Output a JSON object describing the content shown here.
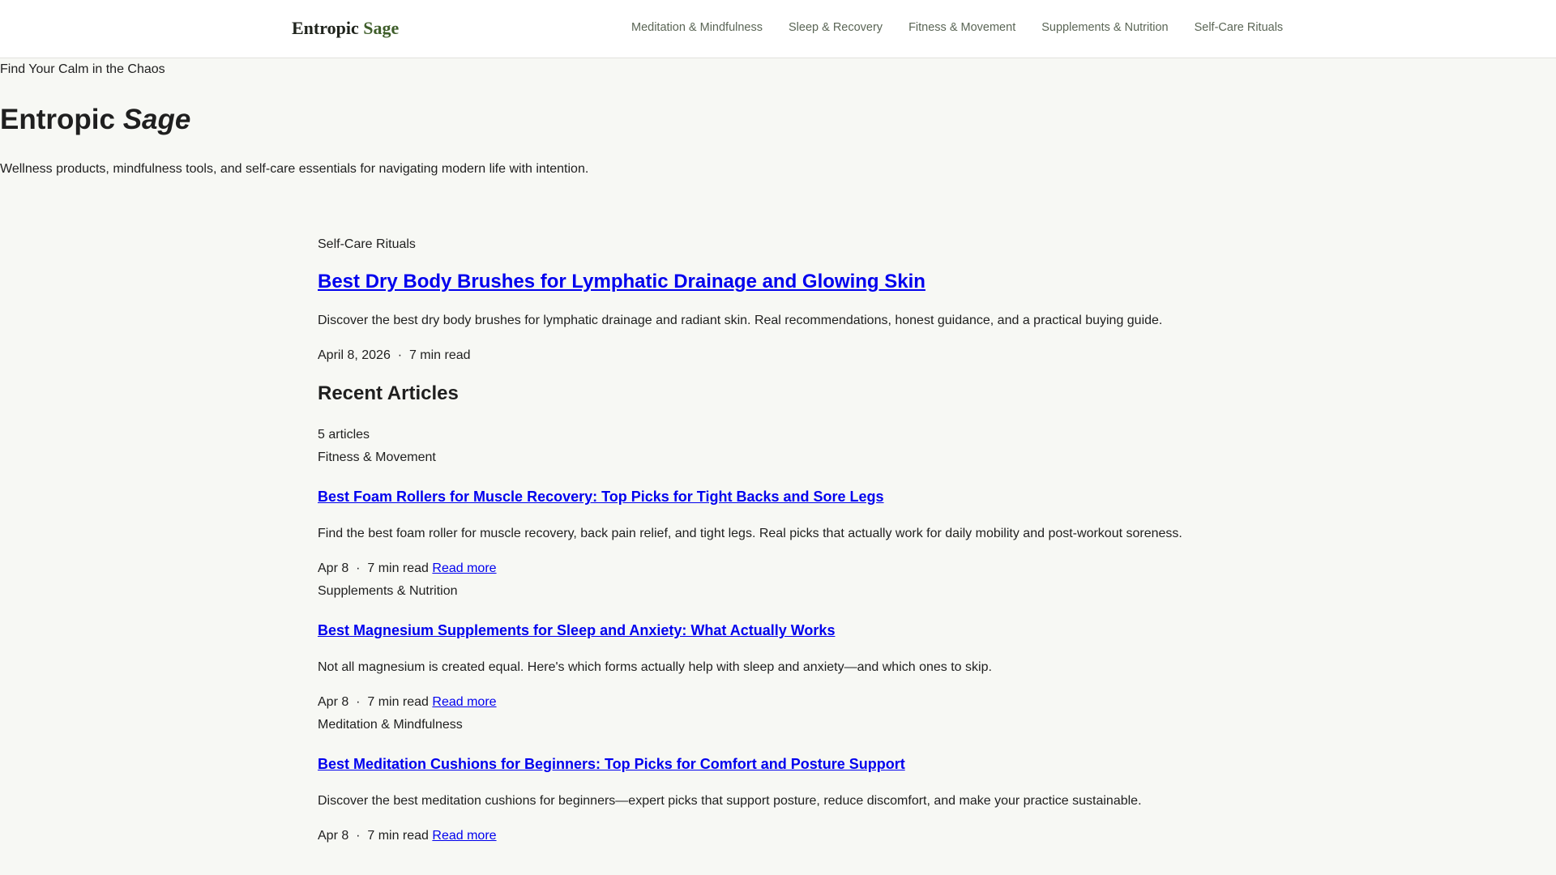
{
  "header": {
    "logo_main": "Entropic",
    "logo_accent": "Sage",
    "nav": [
      "Meditation & Mindfulness",
      "Sleep & Recovery",
      "Fitness & Movement",
      "Supplements & Nutrition",
      "Self-Care Rituals"
    ]
  },
  "hero": {
    "tagline": "Find Your Calm in the Chaos",
    "title_main": "Entropic",
    "title_accent": "Sage",
    "description": "Wellness products, mindfulness tools, and self-care essentials for navigating modern life with intention."
  },
  "featured": {
    "category": "Self-Care Rituals",
    "title": "Best Dry Body Brushes for Lymphatic Drainage and Glowing Skin",
    "description": "Discover the best dry body brushes for lymphatic drainage and radiant skin. Real recommendations, honest guidance, and a practical buying guide.",
    "date": "April 8, 2026",
    "separator": "·",
    "read_time": "7 min read"
  },
  "recent": {
    "heading": "Recent Articles",
    "count": "5 articles",
    "read_more": "Read more",
    "articles": [
      {
        "category": "Fitness & Movement",
        "title": "Best Foam Rollers for Muscle Recovery: Top Picks for Tight Backs and Sore Legs",
        "description": "Find the best foam roller for muscle recovery, back pain relief, and tight legs. Real picks that actually work for daily mobility and post-workout soreness.",
        "date": "Apr 8",
        "read_time": "7 min read"
      },
      {
        "category": "Supplements & Nutrition",
        "title": "Best Magnesium Supplements for Sleep and Anxiety: What Actually Works",
        "description": "Not all magnesium is created equal. Here's which forms actually help with sleep and anxiety—and which ones to skip.",
        "date": "Apr 8",
        "read_time": "7 min read"
      },
      {
        "category": "Meditation & Mindfulness",
        "title": "Best Meditation Cushions for Beginners: Top Picks for Comfort and Posture Support",
        "description": "Discover the best meditation cushions for beginners—expert picks that support posture, reduce discomfort, and make your practice sustainable.",
        "date": "Apr 8",
        "read_time": "7 min read"
      }
    ]
  }
}
